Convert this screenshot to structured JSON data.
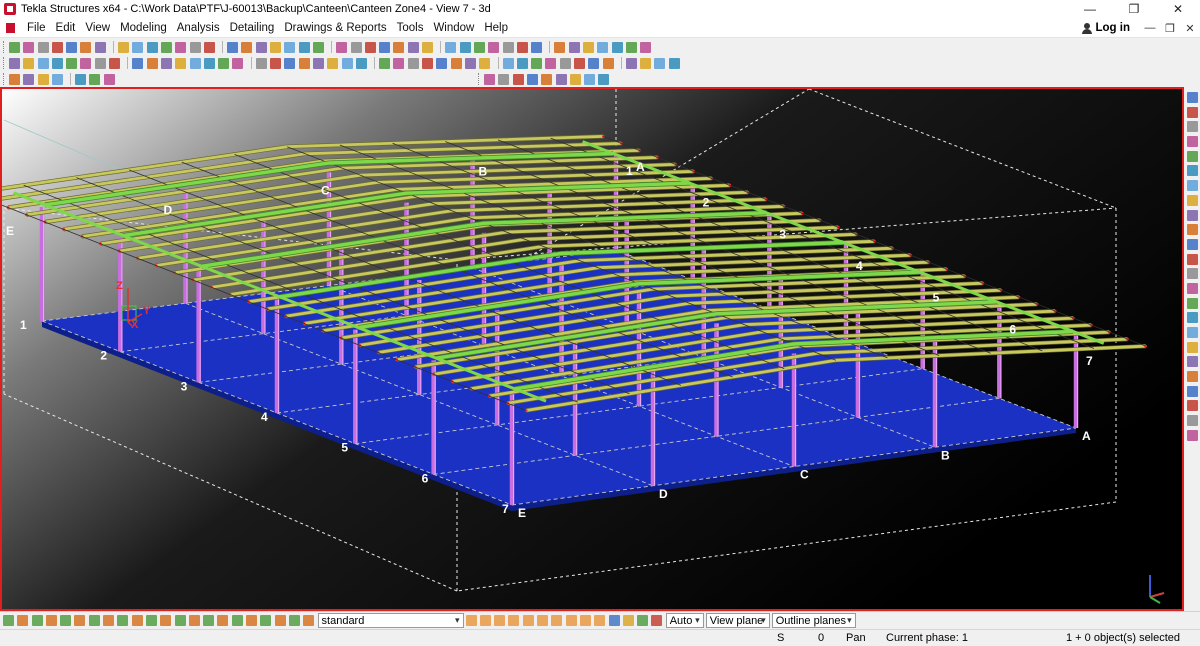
{
  "window": {
    "title": "Tekla Structures x64 - C:\\Work Data\\PTF\\J-60013\\Backup\\Canteen\\Canteen Zone4 - View 7 - 3d",
    "minimize": "—",
    "restore": "❐",
    "close": "✕"
  },
  "menu": {
    "items": [
      "File",
      "Edit",
      "View",
      "Modeling",
      "Analysis",
      "Detailing",
      "Drawings & Reports",
      "Tools",
      "Window",
      "Help"
    ],
    "login_label": "Log in",
    "mdi_minimize": "—",
    "mdi_restore": "❐",
    "mdi_close": "✕"
  },
  "viewport": {
    "gridlines_far_left": [
      "E",
      "D",
      "C",
      "B",
      "A"
    ],
    "gridlines_far_right": [
      "1",
      "2",
      "3",
      "4",
      "5",
      "6",
      "7"
    ],
    "gridlines_near_left": [
      "1",
      "2",
      "3",
      "4",
      "5",
      "6",
      "7"
    ],
    "gridlines_near_right": [
      "E",
      "D",
      "C",
      "B",
      "A"
    ],
    "axis_labels": {
      "x": "X",
      "y": "Y",
      "z": "Z"
    },
    "colors": {
      "slab": "#1a31c4",
      "columns": "#c86ee0",
      "beams": "#c8c860",
      "secondary_beams": "#7ed84a",
      "grid": "#c9c9c9",
      "frame": "#e0201f"
    }
  },
  "bottom_toolbar": {
    "filter_value": "standard",
    "snap_mode": "Auto",
    "plane_mode": "View plane",
    "outline_mode": "Outline planes"
  },
  "status": {
    "mode": "S",
    "count": "0",
    "action": "Pan",
    "phase": "Current phase: 1",
    "selection": "1 + 0 object(s) selected"
  }
}
